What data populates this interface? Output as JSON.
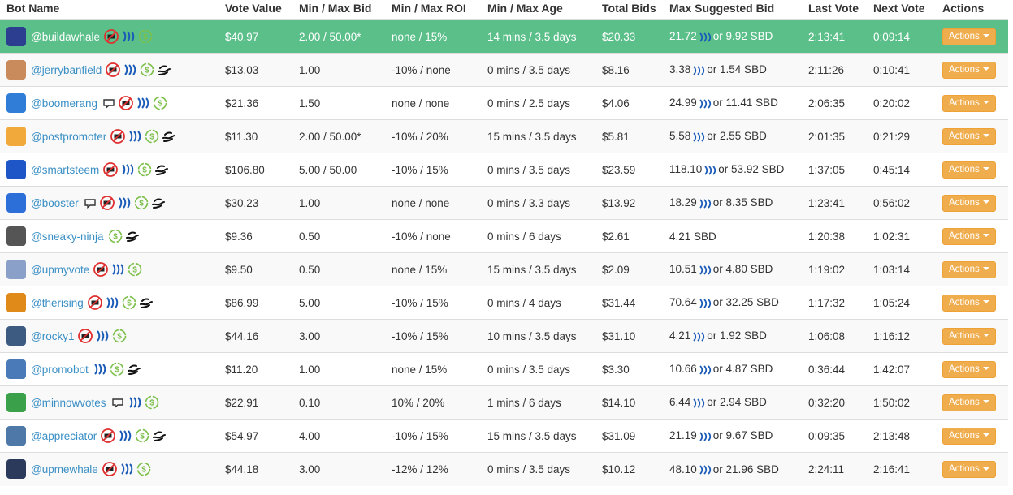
{
  "headers": [
    "Bot Name",
    "Vote Value",
    "Min / Max Bid",
    "Min / Max ROI",
    "Min / Max Age",
    "Total Bids",
    "Max Suggested Bid",
    "Last Vote",
    "Next Vote",
    "Actions"
  ],
  "action_label": "Actions",
  "colors": {
    "highlight": "#5bbf89",
    "link": "#3a8fc5",
    "button": "#f0ad4e",
    "no_comment": "#e03030",
    "refund": "#7cc04b"
  },
  "rows": [
    {
      "name": "@buildawhale",
      "avatar": "#2c3e8f",
      "icons": [
        "no-comment",
        "steem",
        "refund"
      ],
      "vote": "$40.97",
      "bid": "2.00 / 50.00*",
      "roi": "none / 15%",
      "age": "14 mins / 3.5 days",
      "total": "$20.33",
      "sug_a": "21.72",
      "sug_b": "or 9.92 SBD",
      "last": "2:13:41",
      "next": "0:09:14",
      "highlight": true
    },
    {
      "name": "@jerrybanfield",
      "avatar": "#c98b5c",
      "icons": [
        "no-comment",
        "steem",
        "refund",
        "hand"
      ],
      "vote": "$13.03",
      "bid": "1.00",
      "roi": "-10% / none",
      "age": "0 mins / 3.5 days",
      "total": "$8.16",
      "sug_a": "3.38",
      "sug_b": "or 1.54 SBD",
      "last": "2:11:26",
      "next": "0:10:41"
    },
    {
      "name": "@boomerang",
      "avatar": "#2f7dd6",
      "icons": [
        "comment",
        "no-comment",
        "steem",
        "refund"
      ],
      "vote": "$21.36",
      "bid": "1.50",
      "roi": "none / none",
      "age": "0 mins / 2.5 days",
      "total": "$4.06",
      "sug_a": "24.99",
      "sug_b": "or 11.41 SBD",
      "last": "2:06:35",
      "next": "0:20:02"
    },
    {
      "name": "@postpromoter",
      "avatar": "#f2a93b",
      "icons": [
        "no-comment",
        "steem",
        "refund",
        "hand"
      ],
      "vote": "$11.30",
      "bid": "2.00 / 50.00*",
      "roi": "-10% / 20%",
      "age": "15 mins / 3.5 days",
      "total": "$5.81",
      "sug_a": "5.58",
      "sug_b": "or 2.55 SBD",
      "last": "2:01:35",
      "next": "0:21:29"
    },
    {
      "name": "@smartsteem",
      "avatar": "#1f56c7",
      "icons": [
        "no-comment",
        "steem",
        "refund",
        "hand"
      ],
      "vote": "$106.80",
      "bid": "5.00 / 50.00",
      "roi": "-10% / 15%",
      "age": "0 mins / 3.5 days",
      "total": "$23.59",
      "sug_a": "118.10",
      "sug_b": "or 53.92 SBD",
      "last": "1:37:05",
      "next": "0:45:14"
    },
    {
      "name": "@booster",
      "avatar": "#2d6fd9",
      "icons": [
        "comment",
        "no-comment",
        "steem",
        "refund",
        "hand"
      ],
      "vote": "$30.23",
      "bid": "1.00",
      "roi": "none / none",
      "age": "0 mins / 3.3 days",
      "total": "$13.92",
      "sug_a": "18.29",
      "sug_b": "or 8.35 SBD",
      "last": "1:23:41",
      "next": "0:56:02"
    },
    {
      "name": "@sneaky-ninja",
      "avatar": "#555555",
      "icons": [
        "refund",
        "hand"
      ],
      "vote": "$9.36",
      "bid": "0.50",
      "roi": "-10% / none",
      "age": "0 mins / 6 days",
      "total": "$2.61",
      "sug_a": "",
      "sug_b": "4.21 SBD",
      "last": "1:20:38",
      "next": "1:02:31"
    },
    {
      "name": "@upmyvote",
      "avatar": "#8aa0c8",
      "icons": [
        "no-comment",
        "steem",
        "refund"
      ],
      "vote": "$9.50",
      "bid": "0.50",
      "roi": "none / 15%",
      "age": "15 mins / 3.5 days",
      "total": "$2.09",
      "sug_a": "10.51",
      "sug_b": "or 4.80 SBD",
      "last": "1:19:02",
      "next": "1:03:14"
    },
    {
      "name": "@therising",
      "avatar": "#e08a1a",
      "icons": [
        "no-comment",
        "steem",
        "refund",
        "hand"
      ],
      "vote": "$86.99",
      "bid": "5.00",
      "roi": "-10% / 15%",
      "age": "0 mins / 4 days",
      "total": "$31.44",
      "sug_a": "70.64",
      "sug_b": "or 32.25 SBD",
      "last": "1:17:32",
      "next": "1:05:24"
    },
    {
      "name": "@rocky1",
      "avatar": "#3d5a80",
      "icons": [
        "no-comment",
        "steem",
        "refund"
      ],
      "vote": "$44.16",
      "bid": "3.00",
      "roi": "-10% / 15%",
      "age": "10 mins / 3.5 days",
      "total": "$31.10",
      "sug_a": "4.21",
      "sug_b": "or 1.92 SBD",
      "last": "1:06:08",
      "next": "1:16:12"
    },
    {
      "name": "@promobot",
      "avatar": "#4a7ab8",
      "icons": [
        "steem",
        "refund",
        "hand"
      ],
      "vote": "$11.20",
      "bid": "1.00",
      "roi": "none / 15%",
      "age": "0 mins / 3.5 days",
      "total": "$3.30",
      "sug_a": "10.66",
      "sug_b": "or 4.87 SBD",
      "last": "0:36:44",
      "next": "1:42:07"
    },
    {
      "name": "@minnowvotes",
      "avatar": "#3aa04a",
      "icons": [
        "comment",
        "steem",
        "refund"
      ],
      "vote": "$22.91",
      "bid": "0.10",
      "roi": "10% / 20%",
      "age": "1 mins / 6 days",
      "total": "$14.10",
      "sug_a": "6.44",
      "sug_b": "or 2.94 SBD",
      "last": "0:32:20",
      "next": "1:50:02"
    },
    {
      "name": "@appreciator",
      "avatar": "#4d78a8",
      "icons": [
        "no-comment",
        "steem",
        "refund",
        "hand"
      ],
      "vote": "$54.97",
      "bid": "4.00",
      "roi": "-10% / 15%",
      "age": "15 mins / 3.5 days",
      "total": "$31.09",
      "sug_a": "21.19",
      "sug_b": "or 9.67 SBD",
      "last": "0:09:35",
      "next": "2:13:48"
    },
    {
      "name": "@upmewhale",
      "avatar": "#2b3a5a",
      "icons": [
        "no-comment",
        "steem",
        "refund"
      ],
      "vote": "$44.18",
      "bid": "3.00",
      "roi": "-12% / 12%",
      "age": "0 mins / 3.5 days",
      "total": "$10.12",
      "sug_a": "48.10",
      "sug_b": "or 21.96 SBD",
      "last": "2:24:11",
      "next": "2:16:41"
    }
  ]
}
